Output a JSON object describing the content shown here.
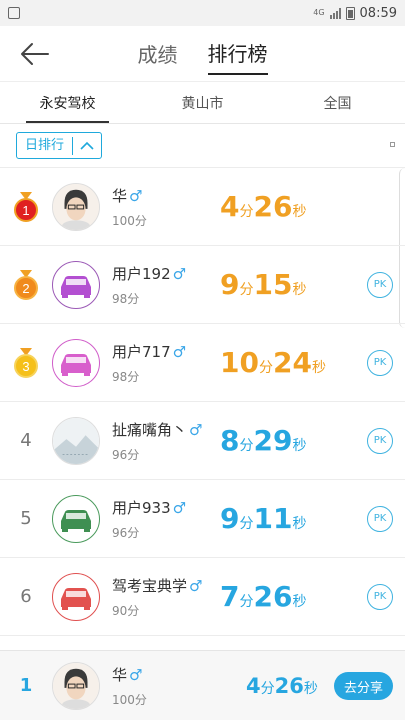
{
  "status_bar": {
    "time": "08:59",
    "network": "4G"
  },
  "header": {
    "tabs": [
      {
        "label": "成绩"
      },
      {
        "label": "排行榜"
      }
    ],
    "active_tab": "排行榜"
  },
  "sub_tabs": [
    {
      "label": "永安驾校"
    },
    {
      "label": "黄山市"
    },
    {
      "label": "全国"
    }
  ],
  "filter": {
    "label": "日排行"
  },
  "rows": [
    {
      "rank": "1",
      "name": "华",
      "score": "100分",
      "t_min": "4",
      "t_sec": "26",
      "color": "#f0a023",
      "avatar": "person",
      "pk": false
    },
    {
      "rank": "2",
      "name": "用户192",
      "score": "98分",
      "t_min": "9",
      "t_sec": "15",
      "color": "#f0a023",
      "avatar": "car-purple",
      "pk": true
    },
    {
      "rank": "3",
      "name": "用户717",
      "score": "98分",
      "t_min": "10",
      "t_sec": "24",
      "color": "#f0a023",
      "avatar": "car-pink",
      "pk": true
    },
    {
      "rank": "4",
      "name": "扯痛嘴角丶",
      "score": "96分",
      "t_min": "8",
      "t_sec": "29",
      "color": "#27a6e0",
      "avatar": "landscape",
      "pk": true
    },
    {
      "rank": "5",
      "name": "用户933",
      "score": "96分",
      "t_min": "9",
      "t_sec": "11",
      "color": "#27a6e0",
      "avatar": "car-green",
      "pk": true
    },
    {
      "rank": "6",
      "name": "驾考宝典学",
      "score": "90分",
      "t_min": "7",
      "t_sec": "26",
      "color": "#27a6e0",
      "avatar": "car-red",
      "pk": true
    }
  ],
  "units": {
    "min": "分",
    "sec": "秒",
    "pk": "PK",
    "male": "♂"
  },
  "bottom": {
    "rank": "1",
    "name": "华",
    "score": "100分",
    "t_min": "4",
    "t_sec": "26",
    "share_label": "去分享"
  }
}
